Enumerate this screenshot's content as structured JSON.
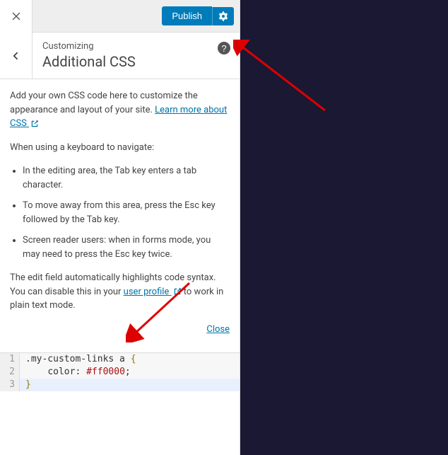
{
  "topbar": {
    "publish_label": "Publish"
  },
  "header": {
    "customizing_label": "Customizing",
    "section_title": "Additional CSS"
  },
  "content": {
    "intro_1": "Add your own CSS code here to customize the appearance and layout of your site. ",
    "learn_more": "Learn more about CSS",
    "keyboard_intro": "When using a keyboard to navigate:",
    "bullets": [
      "In the editing area, the Tab key enters a tab character.",
      "To move away from this area, press the Esc key followed by the Tab key.",
      "Screen reader users: when in forms mode, you may need to press the Esc key twice."
    ],
    "syntax_1": "The edit field automatically highlights code syntax. You can disable this in your ",
    "user_profile": "user profile",
    "syntax_2": " to work in plain text mode.",
    "close_label": "Close"
  },
  "editor": {
    "lines": [
      {
        "n": "1",
        "selector": ".my-custom-links a ",
        "brace": "{"
      },
      {
        "n": "2",
        "indent": "    ",
        "prop": "color",
        "colon": ": ",
        "value": "#ff0000",
        "semi": ";"
      },
      {
        "n": "3",
        "brace": "}"
      }
    ]
  }
}
